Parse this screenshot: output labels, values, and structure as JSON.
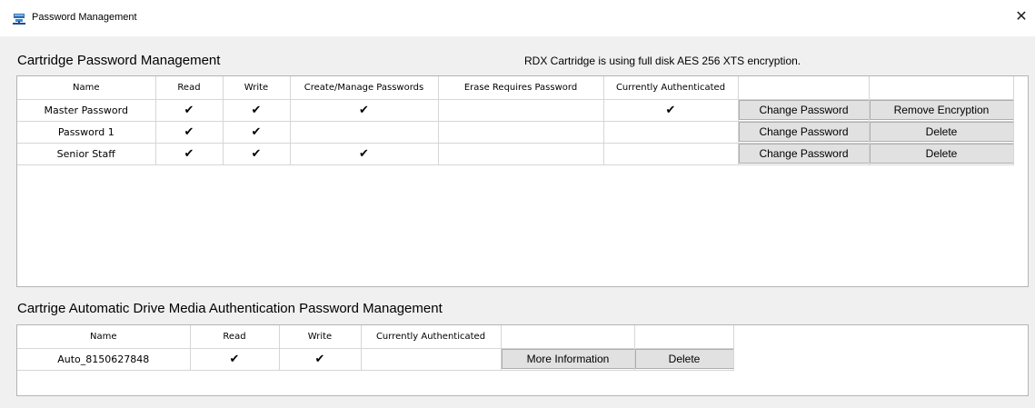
{
  "window": {
    "title": "Password Management",
    "close_glyph": "✕",
    "icon": "network-drive-icon"
  },
  "cartridge": {
    "section_title": "Cartridge Password Management",
    "encryption_note": "RDX Cartridge is using full disk AES 256 XTS encryption.",
    "columns": [
      "Name",
      "Read",
      "Write",
      "Create/Manage Passwords",
      "Erase Requires Password",
      "Currently Authenticated",
      "",
      ""
    ],
    "rows": [
      {
        "name": "Master Password",
        "read": "✔",
        "write": "✔",
        "create_manage": "✔",
        "erase_requires": "",
        "authenticated": "✔",
        "action1": "Change Password",
        "action2": "Remove Encryption"
      },
      {
        "name": "Password 1",
        "read": "✔",
        "write": "✔",
        "create_manage": "",
        "erase_requires": "",
        "authenticated": "",
        "action1": "Change Password",
        "action2": "Delete"
      },
      {
        "name": "Senior Staff",
        "read": "✔",
        "write": "✔",
        "create_manage": "✔",
        "erase_requires": "",
        "authenticated": "",
        "action1": "Change Password",
        "action2": "Delete"
      }
    ]
  },
  "auto_auth": {
    "section_title": "Cartrige Automatic Drive Media Authentication Password Management",
    "columns": [
      "Name",
      "Read",
      "Write",
      "Currently Authenticated",
      "",
      ""
    ],
    "rows": [
      {
        "name": "Auto_8150627848",
        "read": "✔",
        "write": "✔",
        "authenticated": "",
        "action1": "More Information",
        "action2": "Delete"
      }
    ]
  }
}
